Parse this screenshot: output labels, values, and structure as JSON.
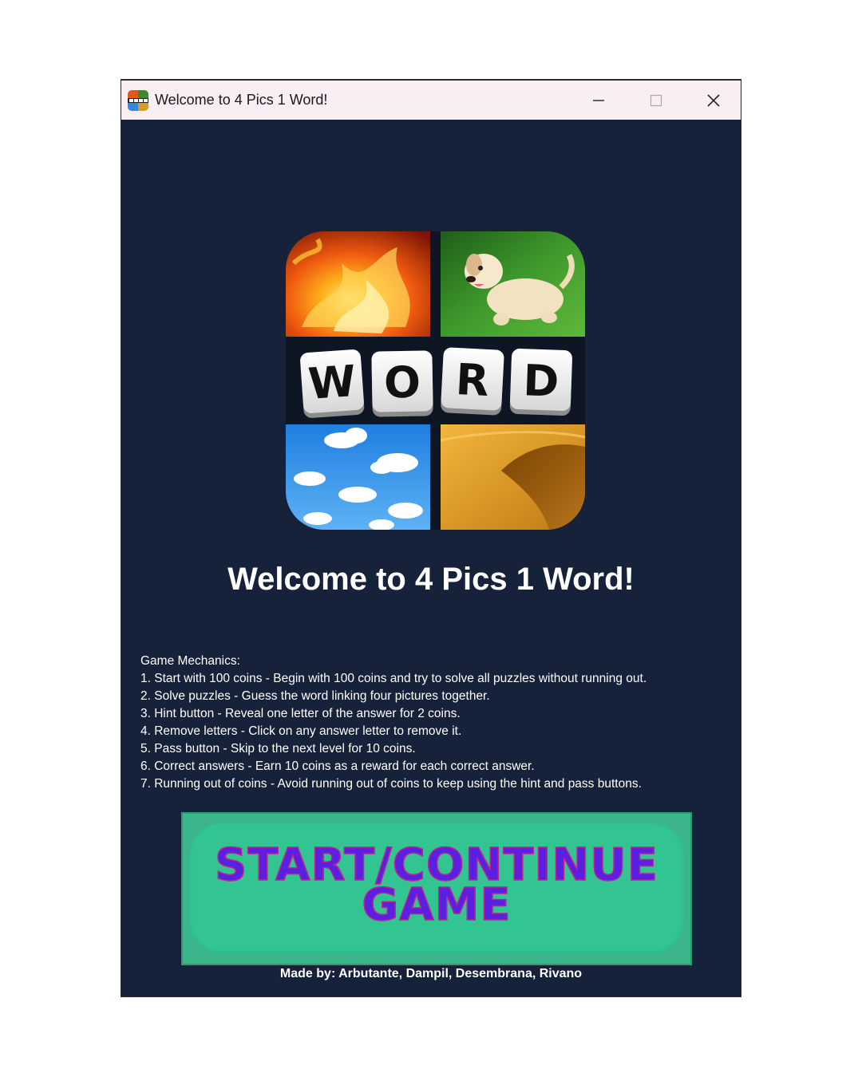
{
  "window": {
    "title": "Welcome to 4 Pics 1 Word!",
    "minimize_label": "minimize",
    "maximize_label": "maximize",
    "close_label": "close"
  },
  "logo": {
    "letters": [
      "W",
      "O",
      "R",
      "D"
    ],
    "tiles": [
      "fire",
      "puppy",
      "sky-clouds",
      "sand-dunes"
    ]
  },
  "heading": "Welcome to 4 Pics 1 Word!",
  "mechanics": {
    "title": "Game Mechanics:",
    "items": [
      "1. Start with 100 coins - Begin with 100 coins and try to solve all puzzles without running out.",
      "2. Solve puzzles - Guess the word linking four pictures together.",
      "3. Hint button - Reveal one letter of the answer for 2 coins.",
      "4. Remove letters - Click on any answer letter to remove it.",
      "5. Pass button - Skip to the next level for 10 coins.",
      "6. Correct answers - Earn 10 coins as a reward for each correct answer.",
      "7. Running out of coins - Avoid running out of coins to keep using the hint and pass buttons."
    ]
  },
  "start_button": {
    "line1": "START/CONTINUE",
    "line2": "GAME"
  },
  "credits": "Made by: Arbutante, Dampil, Desembrana, Rivano",
  "colors": {
    "background": "#16213a",
    "titlebar": "#f8eef3",
    "button_green": "#32c591",
    "button_text": "#5a1fe0",
    "button_text_outline": "#c2208f"
  }
}
